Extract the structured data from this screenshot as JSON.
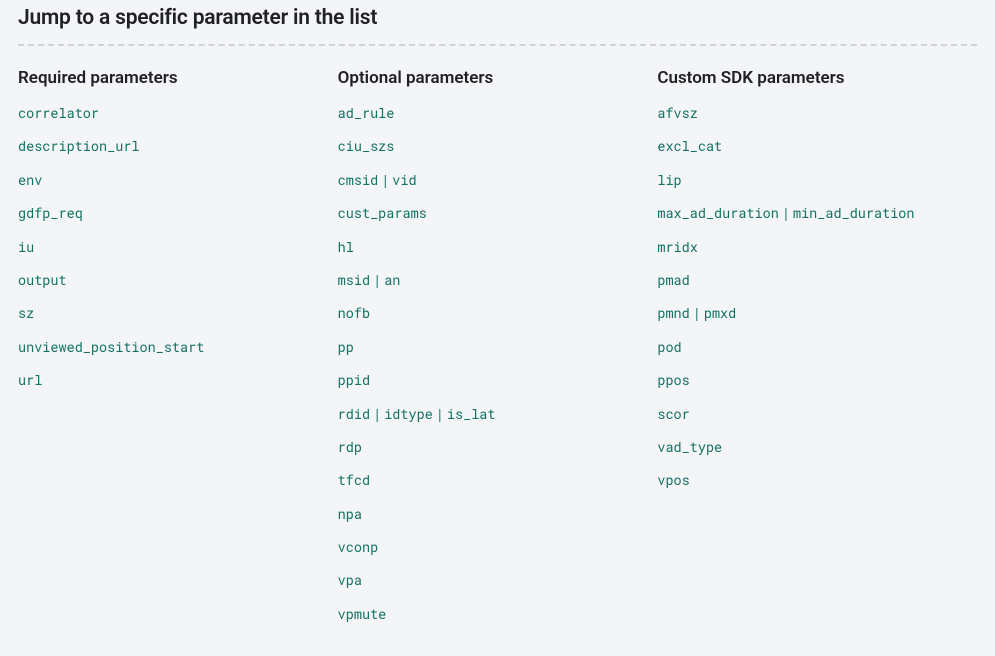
{
  "title": "Jump to a specific parameter in the list",
  "columns": [
    {
      "heading": "Required parameters",
      "items": [
        [
          "correlator"
        ],
        [
          "description_url"
        ],
        [
          "env"
        ],
        [
          "gdfp_req"
        ],
        [
          "iu"
        ],
        [
          "output"
        ],
        [
          "sz"
        ],
        [
          "unviewed_position_start"
        ],
        [
          "url"
        ]
      ]
    },
    {
      "heading": "Optional parameters",
      "items": [
        [
          "ad_rule"
        ],
        [
          "ciu_szs"
        ],
        [
          "cmsid",
          "vid"
        ],
        [
          "cust_params"
        ],
        [
          "hl"
        ],
        [
          "msid",
          "an"
        ],
        [
          "nofb"
        ],
        [
          "pp"
        ],
        [
          "ppid"
        ],
        [
          "rdid",
          "idtype",
          "is_lat"
        ],
        [
          "rdp"
        ],
        [
          "tfcd"
        ],
        [
          "npa"
        ],
        [
          "vconp"
        ],
        [
          "vpa"
        ],
        [
          "vpmute"
        ]
      ]
    },
    {
      "heading": "Custom SDK parameters",
      "items": [
        [
          "afvsz"
        ],
        [
          "excl_cat"
        ],
        [
          "lip"
        ],
        [
          "max_ad_duration",
          "min_ad_duration"
        ],
        [
          "mridx"
        ],
        [
          "pmad"
        ],
        [
          "pmnd",
          "pmxd"
        ],
        [
          "pod"
        ],
        [
          "ppos"
        ],
        [
          "scor"
        ],
        [
          "vad_type"
        ],
        [
          "vpos"
        ]
      ]
    }
  ]
}
